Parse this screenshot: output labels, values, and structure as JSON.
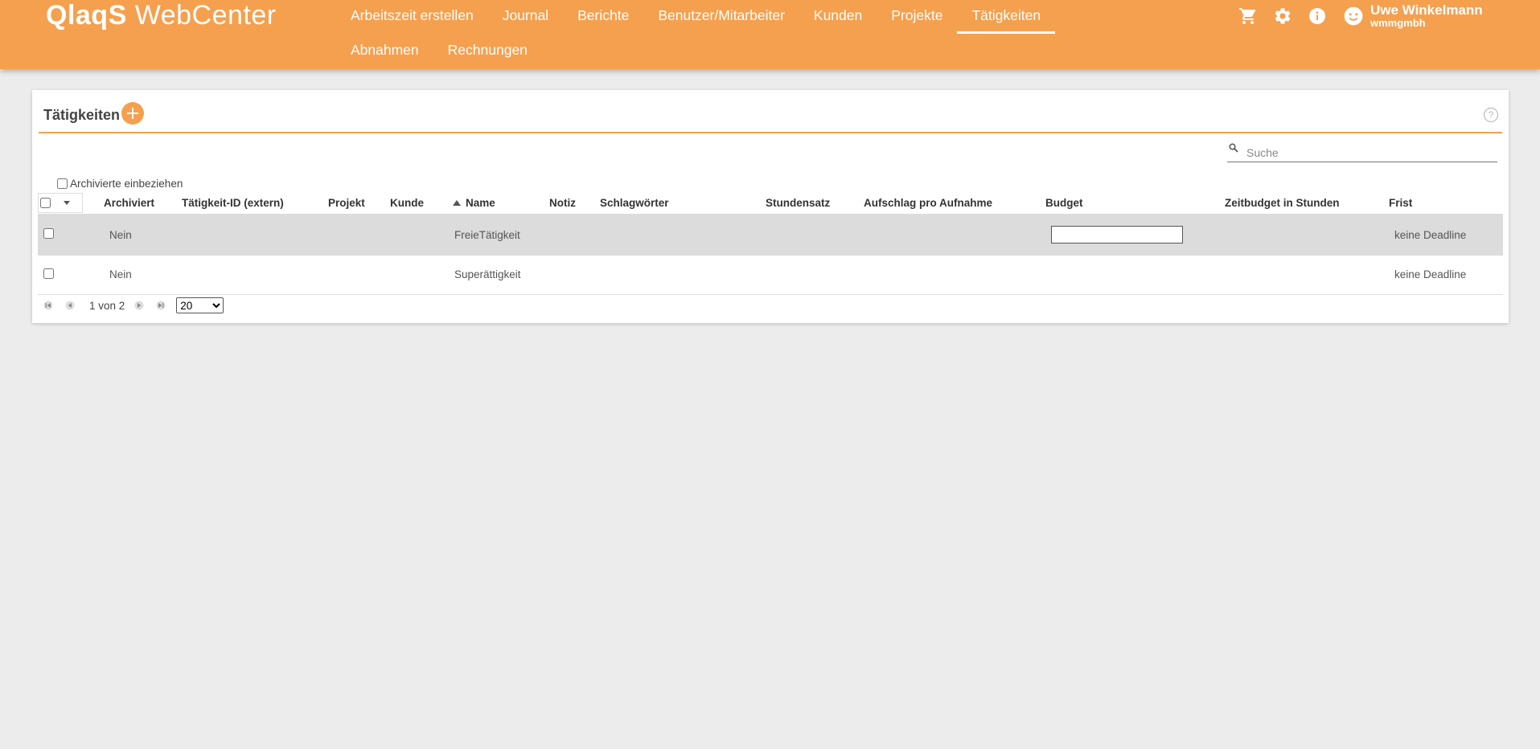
{
  "header": {
    "brand": "QlaqS",
    "product": "WebCenter",
    "nav_row1": [
      {
        "label": "Arbeitszeit erstellen",
        "name": "nav-arbeitszeit-erstellen"
      },
      {
        "label": "Journal",
        "name": "nav-journal"
      },
      {
        "label": "Berichte",
        "name": "nav-berichte"
      },
      {
        "label": "Benutzer/Mitarbeiter",
        "name": "nav-benutzer-mitarbeiter"
      },
      {
        "label": "Kunden",
        "name": "nav-kunden"
      },
      {
        "label": "Projekte",
        "name": "nav-projekte"
      },
      {
        "label": "Tätigkeiten",
        "name": "nav-taetigkeiten"
      }
    ],
    "nav_row2": [
      {
        "label": "Abnahmen",
        "name": "nav-abnahmen"
      },
      {
        "label": "Rechnungen",
        "name": "nav-rechnungen"
      }
    ],
    "active_nav": "Tätigkeiten",
    "icons": [
      "cart-icon",
      "gear-icon",
      "info-icon"
    ],
    "user": {
      "name": "Uwe Winkelmann",
      "org": "wmmgmbh"
    },
    "accent_color": "#f5a04f"
  },
  "card": {
    "title": "Tätigkeiten",
    "search_placeholder": "Suche",
    "archive_label": "Archivierte einbeziehen",
    "columns": [
      "Archiviert",
      "Tätigkeit-ID (extern)",
      "Projekt",
      "Kunde",
      "Name",
      "Notiz",
      "Schlagwörter",
      "Stundensatz",
      "Aufschlag pro Aufnahme",
      "Budget",
      "Zeitbudget in Stunden",
      "Frist"
    ],
    "sorted_column": "Name",
    "rows": [
      {
        "archiviert": "Nein",
        "id": "",
        "projekt": "",
        "kunde": "",
        "name": "FreieTätigkeit",
        "notiz": "",
        "schlagwoerter": "",
        "stundensatz": "",
        "aufschlag": "",
        "budget": "",
        "zeitbudget": "",
        "frist": "keine Deadline"
      },
      {
        "archiviert": "Nein",
        "id": "",
        "projekt": "",
        "kunde": "",
        "name": "Superättigkeit",
        "notiz": "",
        "schlagwoerter": "",
        "stundensatz": "",
        "aufschlag": "",
        "budget": "",
        "zeitbudget": "",
        "frist": "keine Deadline"
      }
    ],
    "pager": {
      "info": "1 von 2",
      "page_size": "20",
      "page_size_options": [
        "20"
      ]
    }
  }
}
